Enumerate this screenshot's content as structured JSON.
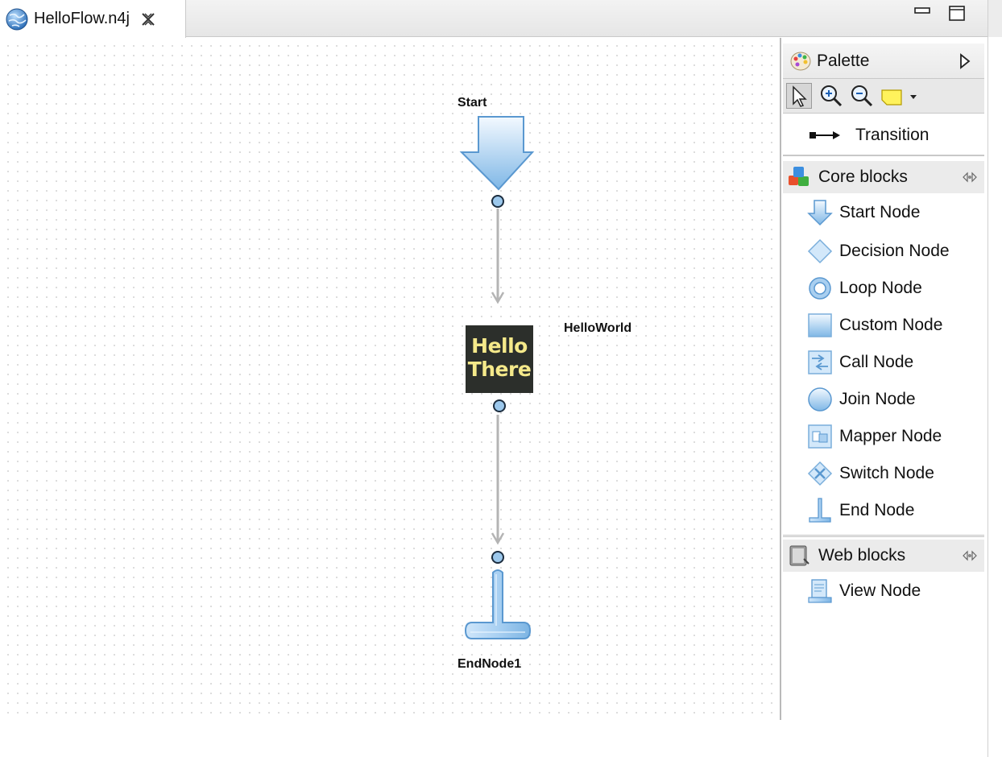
{
  "tab": {
    "title": "HelloFlow.n4j",
    "icon": "flow-globe-icon"
  },
  "window_controls": [
    "minimize-icon",
    "maximize-icon"
  ],
  "diagram": {
    "start_label": "Start",
    "task_label": "HelloWorld",
    "task_image_text": [
      "Hello",
      "There"
    ],
    "end_label": "EndNode1"
  },
  "palette": {
    "title": "Palette",
    "tools": [
      "select-arrow-icon",
      "zoom-in-icon",
      "zoom-out-icon",
      "note-icon"
    ],
    "transition_label": "Transition",
    "core_blocks": {
      "title": "Core blocks",
      "items": [
        "Start Node",
        "Decision Node",
        "Loop Node",
        "Custom Node",
        "Call Node",
        "Join Node",
        "Mapper Node",
        "Switch Node",
        "End Node"
      ]
    },
    "web_blocks": {
      "title": "Web blocks",
      "items": [
        "View Node"
      ]
    }
  },
  "colors": {
    "node_blue": "#9cc8ec",
    "node_stroke": "#4a8cc9",
    "connector": "#b4b4b4"
  }
}
